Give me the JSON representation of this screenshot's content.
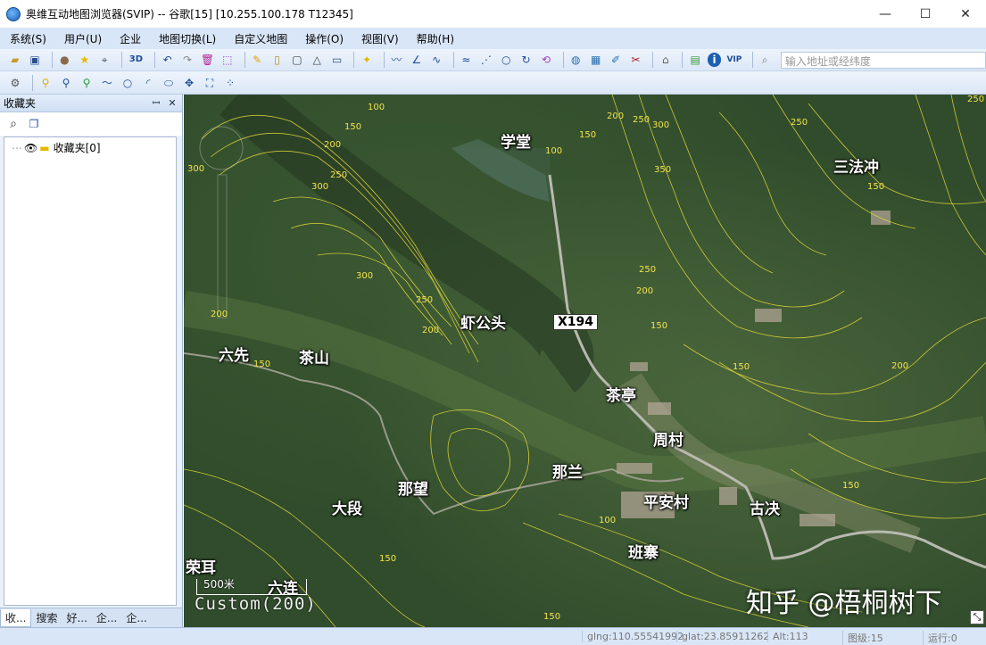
{
  "window": {
    "title": "奥维互动地图浏览器(SVIP) -- 谷歌[15] [10.255.100.178 T12345]",
    "minimize": "—",
    "maximize": "☐",
    "close": "✕"
  },
  "menu": [
    "系统(S)",
    "用户(U)",
    "企业",
    "地图切换(L)",
    "自定义地图",
    "操作(O)",
    "视图(V)",
    "帮助(H)"
  ],
  "toolbar": {
    "btn_3d": "3D",
    "btn_vip": "VIP",
    "search_placeholder": "输入地址或经纬度"
  },
  "sidebar": {
    "title": "收藏夹",
    "pin": "ᅟ¤",
    "close": "✕",
    "tree_root": "收藏夹[0]",
    "tabs": [
      "收...",
      "搜索",
      "好...",
      "企...",
      "企..."
    ]
  },
  "map": {
    "places": [
      {
        "name": "学堂"
      },
      {
        "name": "三法冲"
      },
      {
        "name": "虾公头"
      },
      {
        "name": "六先"
      },
      {
        "name": "茶山"
      },
      {
        "name": "茶亭"
      },
      {
        "name": "周村"
      },
      {
        "name": "那兰"
      },
      {
        "name": "那望"
      },
      {
        "name": "大段"
      },
      {
        "name": "平安村"
      },
      {
        "name": "古决"
      },
      {
        "name": "班寨"
      },
      {
        "name": "荣耳"
      },
      {
        "name": "六连"
      }
    ],
    "road": "X194",
    "contours": [
      "100",
      "150",
      "200",
      "250",
      "300",
      "350"
    ],
    "scale": "500米",
    "custom": "Custom(200)",
    "watermark": "知乎 @梧桐树下"
  },
  "status": {
    "glng": "glng:110.55541992",
    "glat": "glat:23.85911262",
    "alt": "Alt:113",
    "level": "图级:15",
    "run": "运行:0"
  }
}
